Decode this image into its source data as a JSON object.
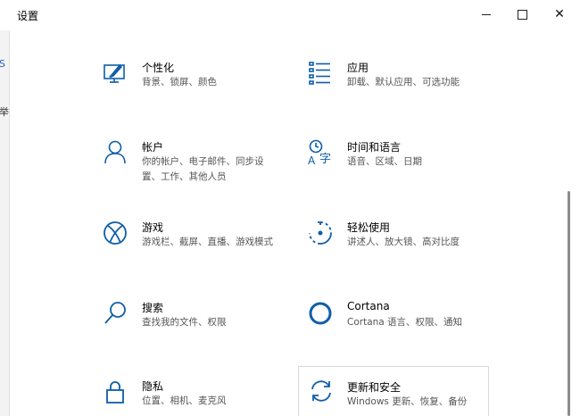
{
  "window": {
    "title": "设置",
    "controls": {
      "minimize_icon": "minimize-icon",
      "maximize_icon": "maximize-icon",
      "close_label": "✕"
    }
  },
  "left_strip": {
    "fragments": [
      "S",
      "举"
    ]
  },
  "accent_color": "#0f5da8",
  "tiles": [
    {
      "id": "personalization",
      "icon": "personalization-icon",
      "name": "个性化",
      "desc": "背景、锁屏、颜色"
    },
    {
      "id": "apps",
      "icon": "apps-list-icon",
      "name": "应用",
      "desc": "卸载、默认应用、可选功能"
    },
    {
      "id": "accounts",
      "icon": "person-icon",
      "name": "帐户",
      "desc": "你的帐户、电子邮件、同步设置、工作、其他人员"
    },
    {
      "id": "time-language",
      "icon": "time-language-icon",
      "name": "时间和语言",
      "desc": "语音、区域、日期"
    },
    {
      "id": "gaming",
      "icon": "xbox-icon",
      "name": "游戏",
      "desc": "游戏栏、截屏、直播、游戏模式"
    },
    {
      "id": "ease-of-access",
      "icon": "ease-of-access-icon",
      "name": "轻松使用",
      "desc": "讲述人、放大镜、高对比度"
    },
    {
      "id": "search",
      "icon": "search-icon",
      "name": "搜索",
      "desc": "查找我的文件、权限"
    },
    {
      "id": "cortana",
      "icon": "cortana-ring-icon",
      "name": "Cortana",
      "desc": "Cortana 语言、权限、通知"
    },
    {
      "id": "privacy",
      "icon": "lock-icon",
      "name": "隐私",
      "desc": "位置、相机、麦克风"
    },
    {
      "id": "update-security",
      "icon": "sync-icon",
      "name": "更新和安全",
      "desc": "Windows 更新、恢复、备份"
    }
  ]
}
